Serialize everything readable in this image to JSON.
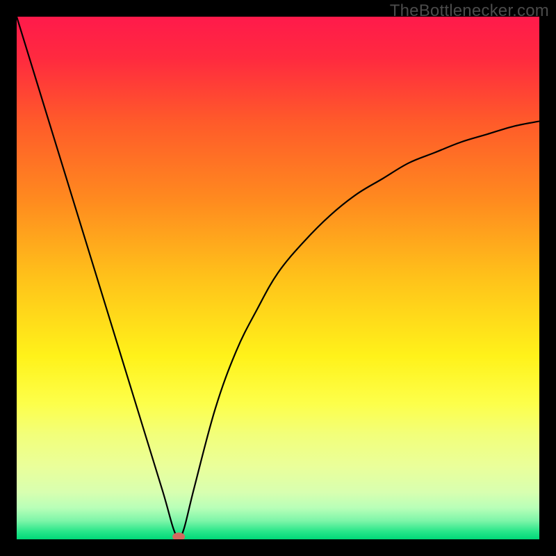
{
  "watermark": "TheBottlenecker.com",
  "colors": {
    "frame_bg": "#000000",
    "curve": "#000000",
    "marker": "#d46a5f",
    "gradient_stops": [
      {
        "offset": 0.0,
        "color": "#ff1a4b"
      },
      {
        "offset": 0.08,
        "color": "#ff2a3f"
      },
      {
        "offset": 0.2,
        "color": "#ff5a2a"
      },
      {
        "offset": 0.35,
        "color": "#ff8a1f"
      },
      {
        "offset": 0.5,
        "color": "#ffc21a"
      },
      {
        "offset": 0.65,
        "color": "#fff21a"
      },
      {
        "offset": 0.74,
        "color": "#fdff4a"
      },
      {
        "offset": 0.8,
        "color": "#f2ff7a"
      },
      {
        "offset": 0.86,
        "color": "#eaff9a"
      },
      {
        "offset": 0.91,
        "color": "#d8ffb0"
      },
      {
        "offset": 0.94,
        "color": "#b8ffb8"
      },
      {
        "offset": 0.965,
        "color": "#7cf5a8"
      },
      {
        "offset": 0.985,
        "color": "#28e68a"
      },
      {
        "offset": 1.0,
        "color": "#00d878"
      }
    ]
  },
  "chart_data": {
    "type": "line",
    "title": "",
    "xlabel": "",
    "ylabel": "",
    "xlim": [
      0,
      100
    ],
    "ylim": [
      0,
      100
    ],
    "grid": false,
    "legend": false,
    "annotations": [
      "TheBottlenecker.com"
    ],
    "series": [
      {
        "name": "bottleneck-curve",
        "x": [
          0,
          4,
          8,
          12,
          16,
          20,
          24,
          28,
          30,
          31,
          32,
          34,
          38,
          42,
          46,
          50,
          55,
          60,
          65,
          70,
          75,
          80,
          85,
          90,
          95,
          100
        ],
        "y": [
          100,
          87,
          74,
          61,
          48,
          35,
          22,
          9,
          2,
          0.5,
          2,
          10,
          25,
          36,
          44,
          51,
          57,
          62,
          66,
          69,
          72,
          74,
          76,
          77.5,
          79,
          80
        ]
      }
    ],
    "marker": {
      "x": 31,
      "y": 0.5
    }
  }
}
